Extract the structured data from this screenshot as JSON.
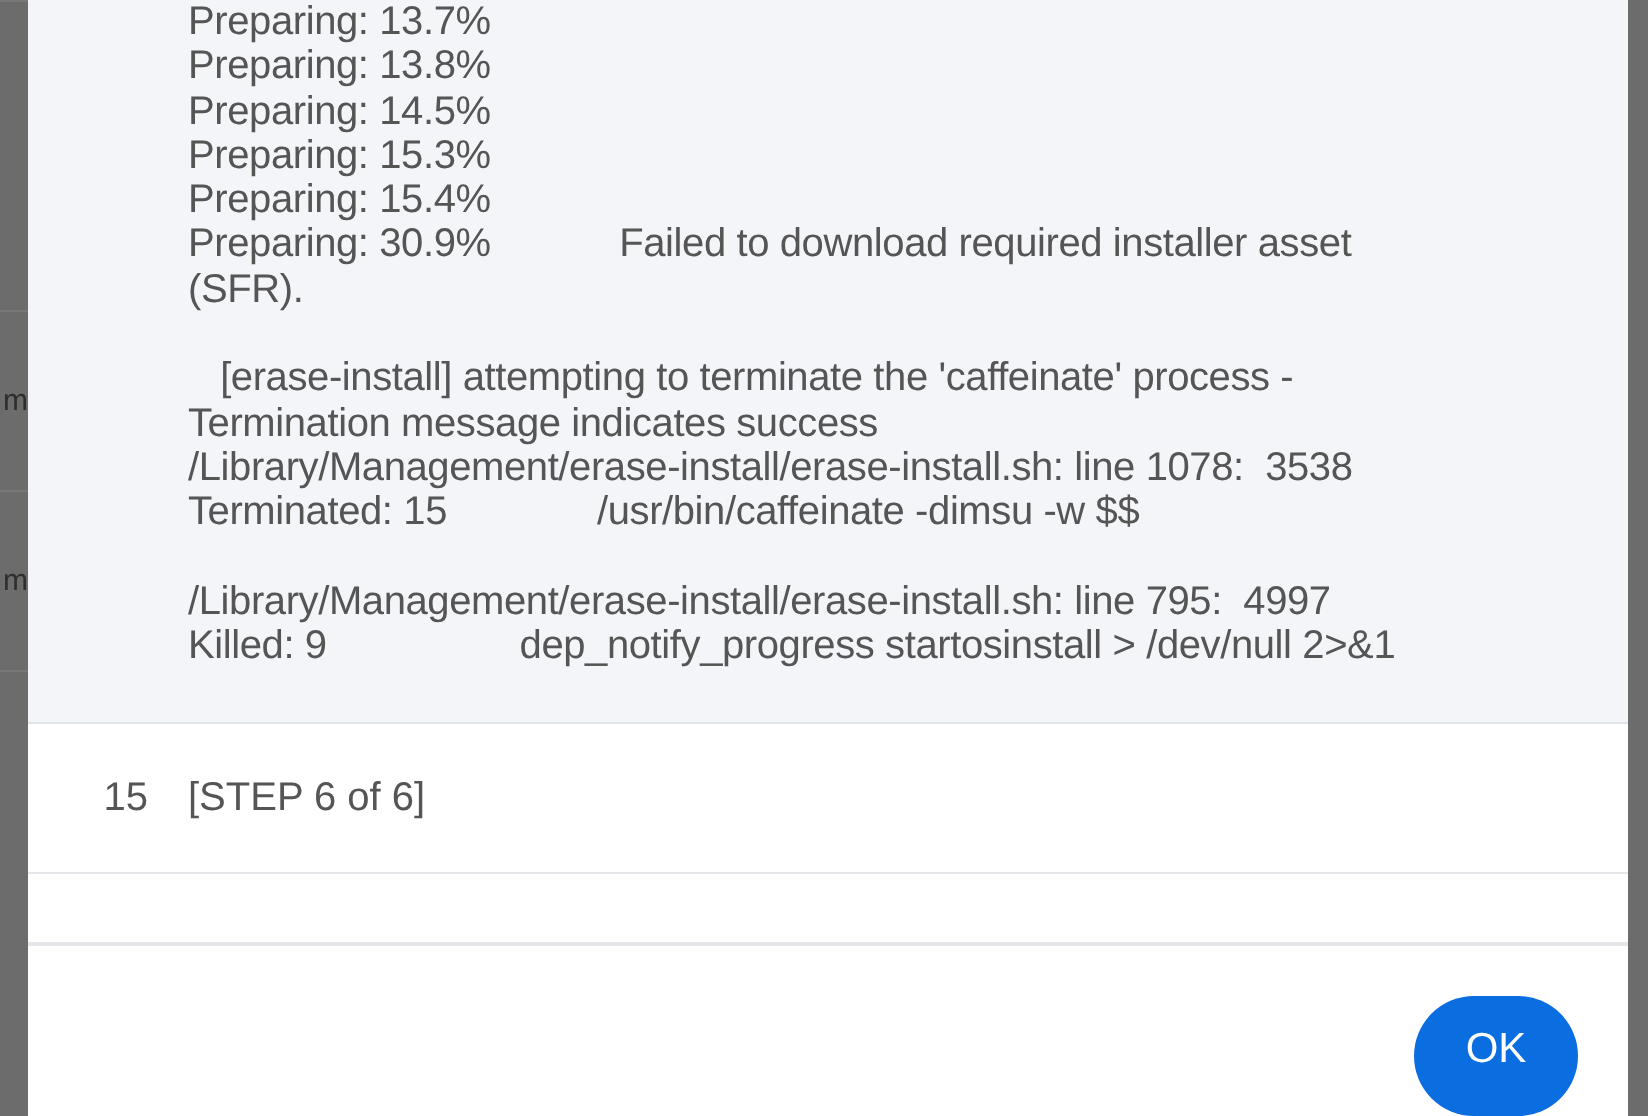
{
  "background_rows": [
    "m",
    "m"
  ],
  "log": {
    "paragraphs": [
      [
        "Preparing: 13.7%",
        "Preparing: 13.8%",
        "Preparing: 14.5%",
        "Preparing: 15.3%",
        "Preparing: 15.4%",
        "Preparing: 30.9%            Failed to download required installer asset",
        "(SFR)."
      ],
      [
        "   [erase-install] attempting to terminate the 'caffeinate' process -",
        "Termination message indicates success",
        "/Library/Management/erase-install/erase-install.sh: line 1078:  3538",
        "Terminated: 15              /usr/bin/caffeinate -dimsu -w $$"
      ],
      [
        "/Library/Management/erase-install/erase-install.sh: line 795:  4997",
        "Killed: 9                  dep_notify_progress startosinstall > /dev/null 2>&1"
      ]
    ]
  },
  "rows": [
    {
      "number": "15",
      "text": "[STEP 6 of 6]"
    }
  ],
  "buttons": [
    "OK"
  ]
}
